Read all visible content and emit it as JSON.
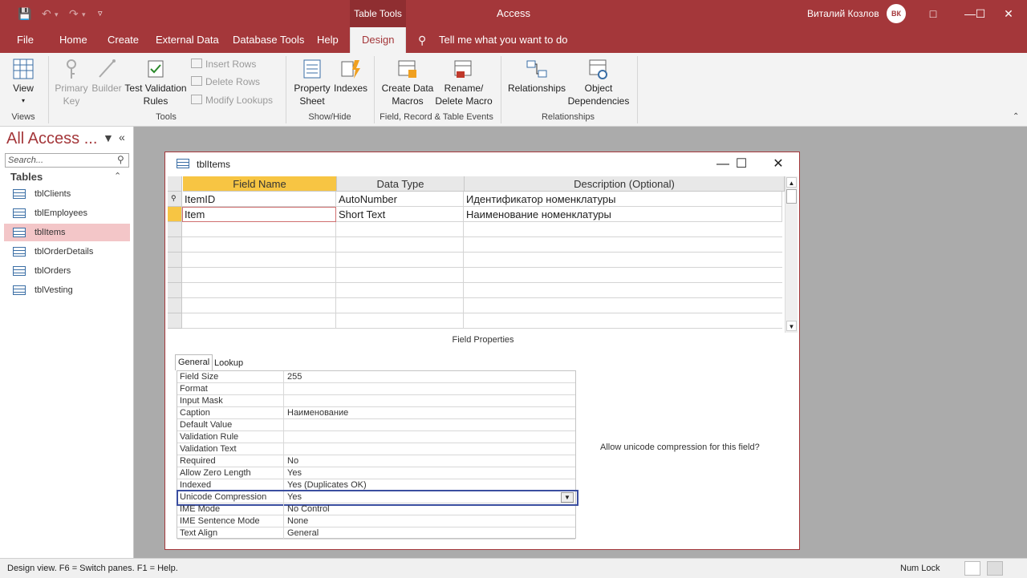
{
  "titlebar": {
    "contextual_tab": "Table Tools",
    "app_title": "Access",
    "user_name": "Виталий Козлов",
    "avatar_text": "ВК"
  },
  "menu": {
    "file": "File",
    "home": "Home",
    "create": "Create",
    "external_data": "External Data",
    "database_tools": "Database Tools",
    "help": "Help",
    "design": "Design",
    "tell_me": "Tell me what you want to do"
  },
  "ribbon": {
    "view": "View",
    "primary_key": "Primary Key",
    "builder": "Builder",
    "test_validation": "Test Validation Rules",
    "insert_rows": "Insert Rows",
    "delete_rows": "Delete Rows",
    "modify_lookups": "Modify Lookups",
    "property_sheet": "Property Sheet",
    "indexes": "Indexes",
    "create_data_macros": "Create Data Macros",
    "rename_delete_macro": "Rename/ Delete Macro",
    "relationships": "Relationships",
    "object_dependencies": "Object Dependencies",
    "groups": {
      "views": "Views",
      "tools": "Tools",
      "show_hide": "Show/Hide",
      "field_record": "Field, Record & Table Events",
      "relationships": "Relationships"
    }
  },
  "nav": {
    "title": "All Access ...",
    "search_placeholder": "Search...",
    "section": "Tables",
    "items": [
      "tblClients",
      "tblEmployees",
      "tblItems",
      "tblOrderDetails",
      "tblOrders",
      "tblVesting"
    ]
  },
  "doc": {
    "title": "tblItems",
    "columns": [
      "Field Name",
      "Data Type",
      "Description (Optional)"
    ],
    "rows": [
      {
        "name": "ItemID",
        "type": "AutoNumber",
        "desc": "Идентификатор номенклатуры"
      },
      {
        "name": "Item",
        "type": "Short Text",
        "desc": "Наименование номенклатуры"
      }
    ],
    "field_properties_title": "Field Properties",
    "tabs": [
      "General",
      "Lookup"
    ],
    "properties": [
      {
        "name": "Field Size",
        "value": "255"
      },
      {
        "name": "Format",
        "value": ""
      },
      {
        "name": "Input Mask",
        "value": ""
      },
      {
        "name": "Caption",
        "value": "Наименование"
      },
      {
        "name": "Default Value",
        "value": ""
      },
      {
        "name": "Validation Rule",
        "value": ""
      },
      {
        "name": "Validation Text",
        "value": ""
      },
      {
        "name": "Required",
        "value": "No"
      },
      {
        "name": "Allow Zero Length",
        "value": "Yes"
      },
      {
        "name": "Indexed",
        "value": "Yes (Duplicates OK)"
      },
      {
        "name": "Unicode Compression",
        "value": "Yes"
      },
      {
        "name": "IME Mode",
        "value": "No Control"
      },
      {
        "name": "IME Sentence Mode",
        "value": "None"
      },
      {
        "name": "Text Align",
        "value": "General"
      }
    ],
    "hint": "Allow unicode compression for this field?"
  },
  "status": {
    "left": "Design view.  F6 = Switch panes.  F1 = Help.",
    "num_lock": "Num Lock"
  },
  "colors": {
    "accent": "#a4373a",
    "selected_nav": "#f3c6c8",
    "active_header": "#f7c543",
    "focus_border": "#3a4ea0"
  }
}
